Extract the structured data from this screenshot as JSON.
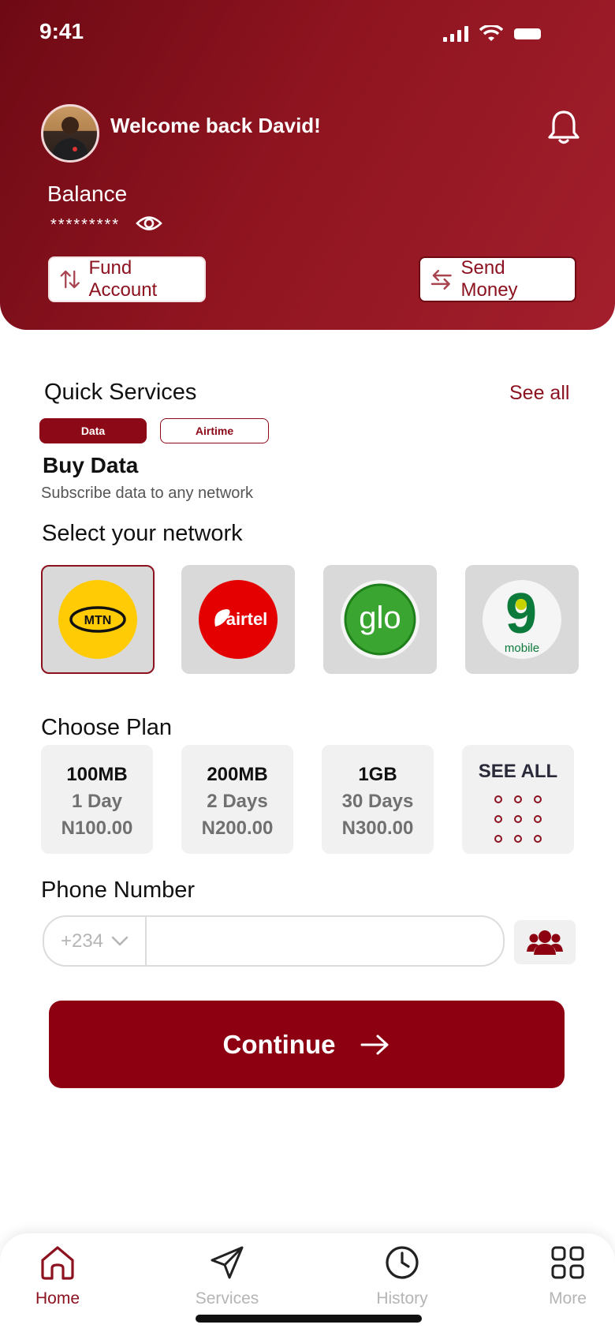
{
  "status_bar": {
    "time": "9:41"
  },
  "header": {
    "welcome": "Welcome back David!",
    "balance_label": "Balance",
    "balance_value": "*********",
    "fund_account": "Fund Account",
    "send_money": "Send Money"
  },
  "quick_services": {
    "title": "Quick Services",
    "see_all": "See all",
    "tabs": [
      "Data",
      "Airtime"
    ],
    "active_tab": "Data"
  },
  "buy_data": {
    "title": "Buy Data",
    "subtitle": "Subscribe data to any network"
  },
  "network": {
    "title": "Select your network",
    "options": [
      {
        "logo_text": "MTN",
        "selected": true
      },
      {
        "logo_text": "airtel",
        "selected": false
      },
      {
        "logo_text": "glo",
        "selected": false
      },
      {
        "logo_text": "9",
        "logo_subtext": "mobile",
        "selected": false
      }
    ]
  },
  "plans": {
    "title": "Choose Plan",
    "items": [
      {
        "size": "100MB",
        "duration": "1 Day",
        "price": "N100.00"
      },
      {
        "size": "200MB",
        "duration": "2 Days",
        "price": "N200.00"
      },
      {
        "size": "1GB",
        "duration": "30 Days",
        "price": "N300.00"
      }
    ],
    "see_all": "SEE ALL"
  },
  "phone": {
    "title": "Phone Number",
    "country_code": "+234",
    "value": ""
  },
  "continue_label": "Continue",
  "bottom_nav": {
    "items": [
      {
        "label": "Home",
        "active": true
      },
      {
        "label": "Services",
        "active": false
      },
      {
        "label": "History",
        "active": false
      },
      {
        "label": "More",
        "active": false
      }
    ]
  },
  "colors": {
    "brand": "#8c0012",
    "header_gradient_start": "#6e0a14",
    "header_gradient_end": "#a31f2c",
    "mtn_yellow": "#ffcb05",
    "airtel_red": "#e40000",
    "glo_green": "#3aa631",
    "nine_mobile_green": "#0b7a3b"
  }
}
